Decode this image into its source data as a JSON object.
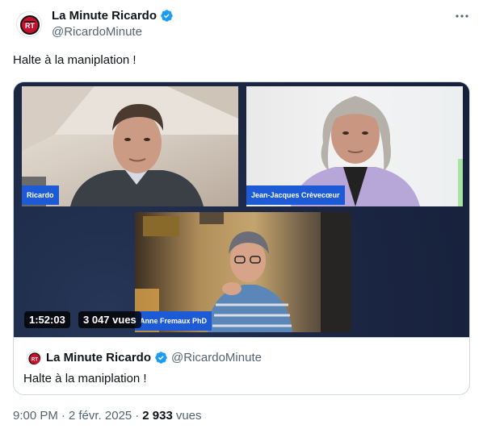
{
  "author": {
    "name": "La Minute Ricardo",
    "handle": "@RicardoMinute",
    "avatar_text": "RT"
  },
  "tweet": {
    "text": "Halte à la maniplation !"
  },
  "video": {
    "duration": "1:52:03",
    "views": "3 047 vues",
    "participants": [
      {
        "label": "Ricardo"
      },
      {
        "label": "Jean-Jacques Crèvecœur"
      },
      {
        "label": "Anne Fremaux PhD"
      }
    ]
  },
  "quoted": {
    "name": "La Minute Ricardo",
    "handle": "@RicardoMinute",
    "text": "Halte à la maniplation !"
  },
  "meta": {
    "time": "9:00 PM",
    "date": "2 févr. 2025",
    "views_count": "2 933",
    "views_label": "vues"
  },
  "colors": {
    "verified": "#1d9bf0",
    "name_tag": "#1d5ad6",
    "video_bg": "#1d2a4a"
  }
}
